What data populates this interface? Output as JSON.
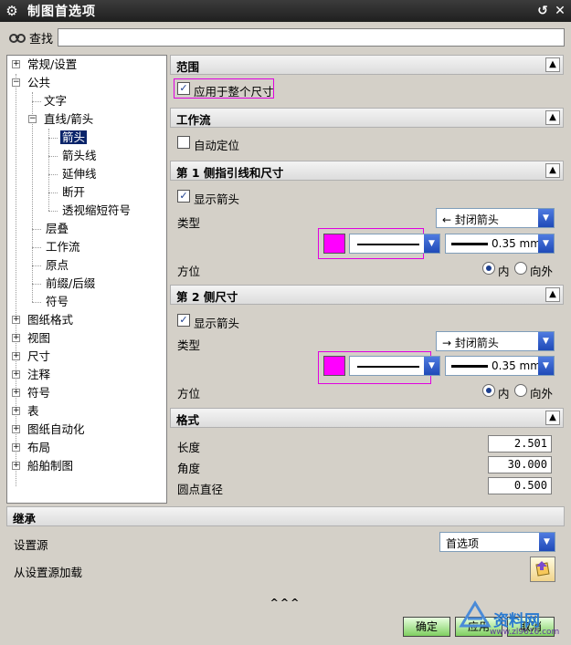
{
  "window": {
    "title": "制图首选项"
  },
  "search": {
    "label": "查找",
    "placeholder": ""
  },
  "tree": {
    "items": [
      {
        "label": "常规/设置",
        "expander": "+"
      },
      {
        "label": "公共",
        "expander": "−"
      },
      {
        "label": "文字"
      },
      {
        "label": "直线/箭头",
        "expander": "−"
      },
      {
        "label": "箭头",
        "selected": true
      },
      {
        "label": "箭头线"
      },
      {
        "label": "延伸线"
      },
      {
        "label": "断开"
      },
      {
        "label": "透视缩短符号"
      },
      {
        "label": "层叠"
      },
      {
        "label": "工作流"
      },
      {
        "label": "原点"
      },
      {
        "label": "前缀/后缀"
      },
      {
        "label": "符号"
      },
      {
        "label": "图纸格式",
        "expander": "+"
      },
      {
        "label": "视图",
        "expander": "+"
      },
      {
        "label": "尺寸",
        "expander": "+"
      },
      {
        "label": "注释",
        "expander": "+"
      },
      {
        "label": "符号",
        "expander": "+"
      },
      {
        "label": "表",
        "expander": "+"
      },
      {
        "label": "图纸自动化",
        "expander": "+"
      },
      {
        "label": "布局",
        "expander": "+"
      },
      {
        "label": "船舶制图",
        "expander": "+"
      }
    ]
  },
  "sections": {
    "scope": {
      "title": "范围",
      "apply_all": {
        "label": "应用于整个尺寸",
        "checked": true
      }
    },
    "workflow": {
      "title": "工作流",
      "auto_place": {
        "label": "自动定位",
        "checked": false
      }
    },
    "side1": {
      "title": "第 1 侧指引线和尺寸",
      "show_arrow": {
        "label": "显示箭头",
        "checked": true
      },
      "type_label": "类型",
      "type_value": "封闭箭头",
      "type_glyph": "←",
      "color": "#ff00ff",
      "width_value": "0.35 mm",
      "orientation_label": "方位",
      "inner": "内",
      "outer": "向外",
      "selected": "内"
    },
    "side2": {
      "title": "第 2 侧尺寸",
      "show_arrow": {
        "label": "显示箭头",
        "checked": true
      },
      "type_label": "类型",
      "type_value": "封闭箭头",
      "type_glyph": "→",
      "color": "#ff00ff",
      "width_value": "0.35 mm",
      "orientation_label": "方位",
      "inner": "内",
      "outer": "向外",
      "selected": "内"
    },
    "format": {
      "title": "格式",
      "length_label": "长度",
      "length_value": "2.501",
      "angle_label": "角度",
      "angle_value": "30.000",
      "dot_label": "圆点直径",
      "dot_value": "0.500"
    }
  },
  "inherit": {
    "title": "继承",
    "source_label": "设置源",
    "source_value": "首选项",
    "load_label": "从设置源加载"
  },
  "expand_glyph": "^^^",
  "buttons": {
    "ok": "确定",
    "apply": "应用",
    "cancel": "取消"
  },
  "watermark": {
    "brand": "资料网",
    "url": "www.zl9616.com"
  },
  "colors": {
    "accent": "#0a246a",
    "highlight": "#e000e0",
    "title_bg": "#2a2a2a"
  }
}
